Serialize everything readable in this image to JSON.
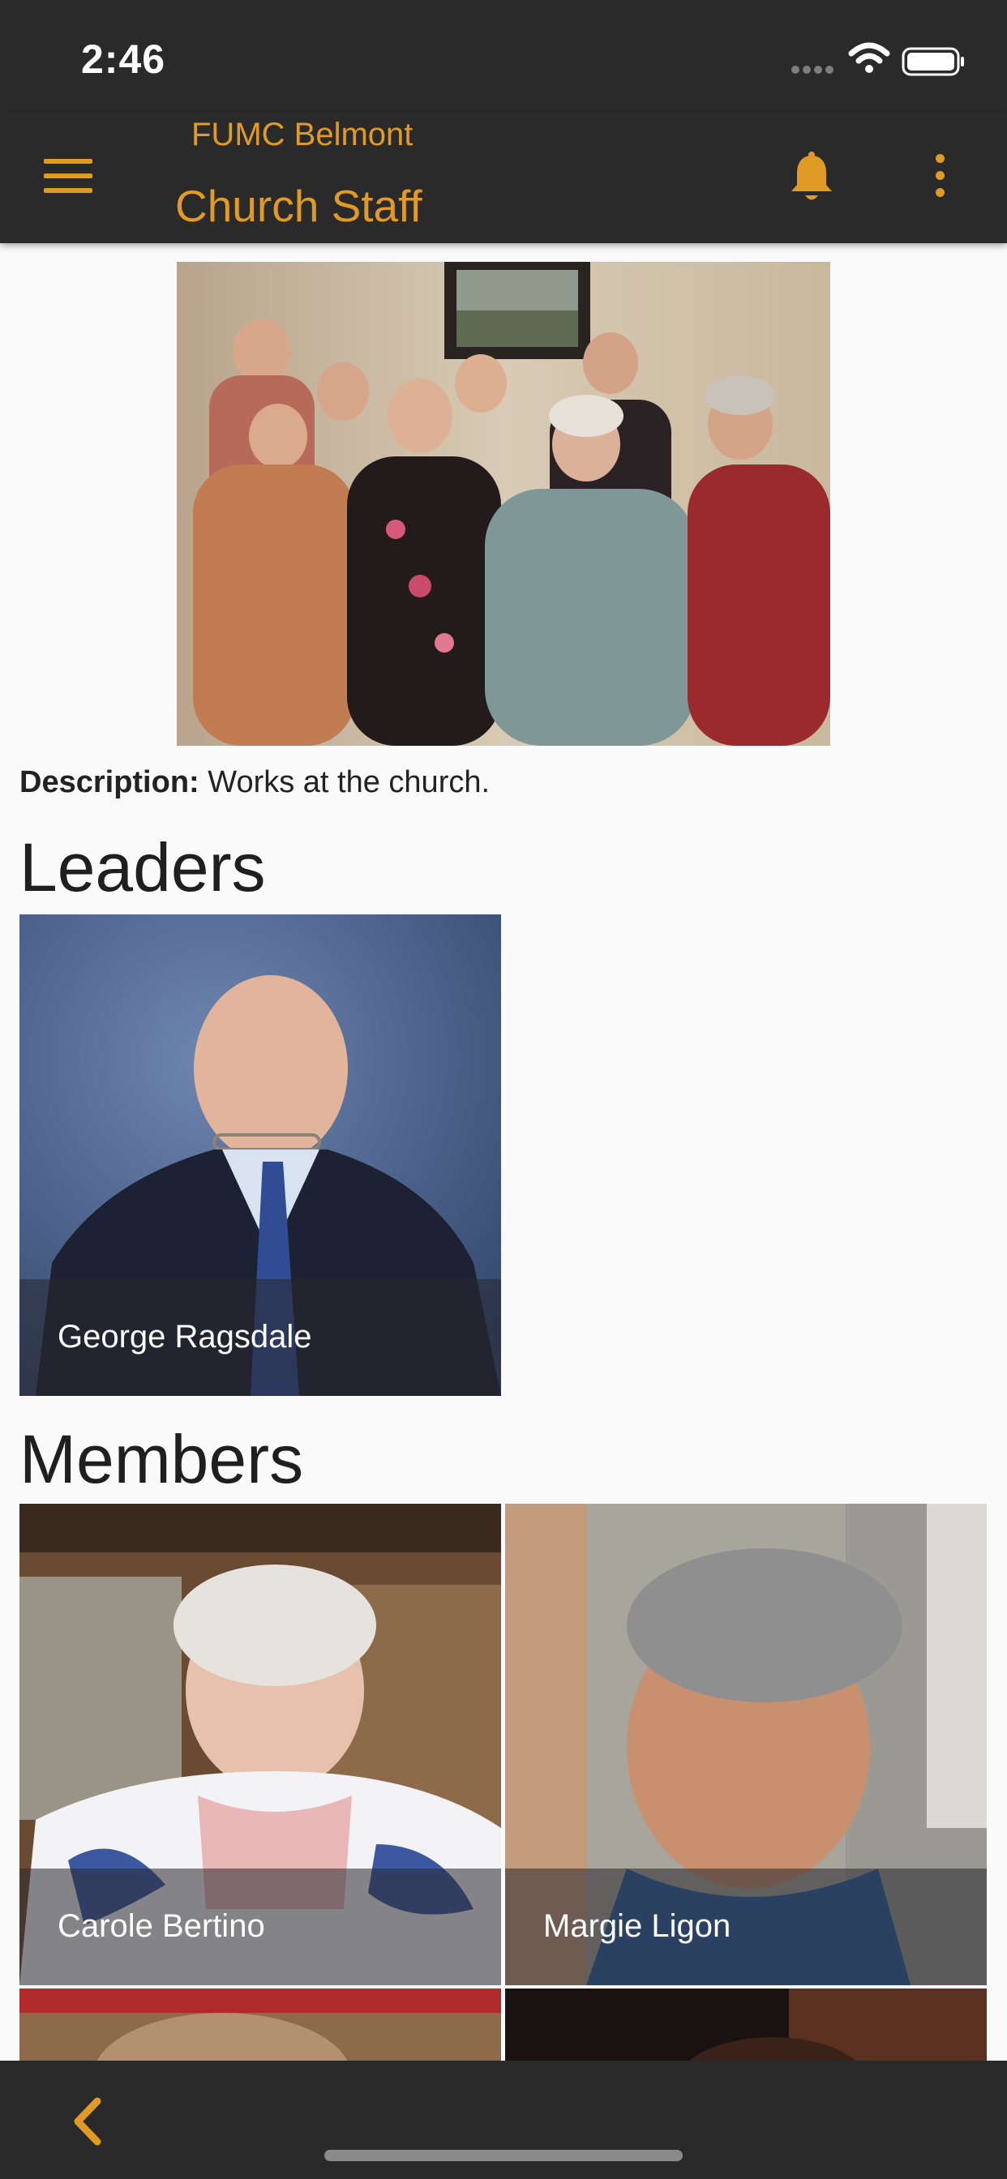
{
  "status_bar": {
    "time": "2:46",
    "icons": [
      "signal-dots-icon",
      "wifi-icon",
      "battery-icon"
    ]
  },
  "app_bar": {
    "subtitle": "FUMC Belmont",
    "title": "Church Staff",
    "accent_color": "#e09a26",
    "background_color": "#2a2a2a",
    "icons": [
      "menu-icon",
      "bell-icon",
      "more-vertical-icon"
    ]
  },
  "group": {
    "description_label": "Description:",
    "description_text": "Works at the church."
  },
  "leaders": {
    "heading": "Leaders",
    "people": [
      {
        "name": "George Ragsdale"
      }
    ]
  },
  "members": {
    "heading": "Members",
    "people": [
      {
        "name": "Carole Bertino"
      },
      {
        "name": "Margie Ligon"
      },
      {
        "name": ""
      },
      {
        "name": ""
      }
    ]
  },
  "bottom_bar": {
    "icons": [
      "chevron-left-icon"
    ]
  }
}
